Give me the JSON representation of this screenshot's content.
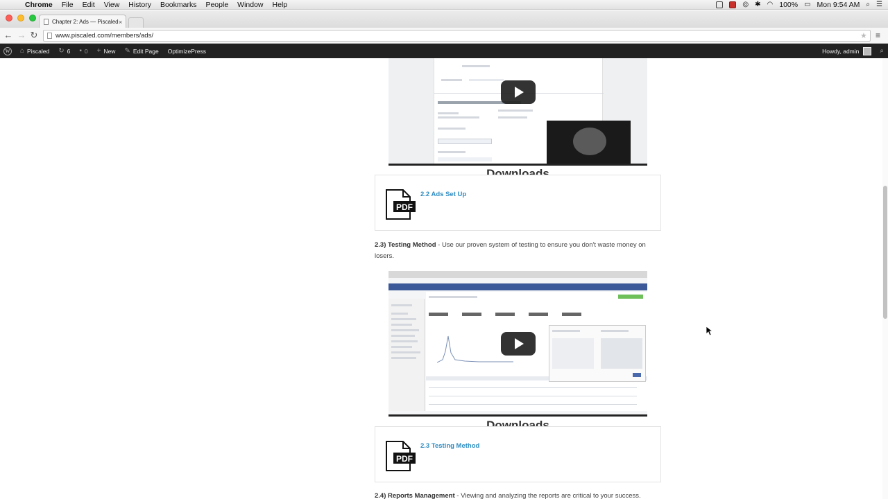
{
  "mac_menubar": {
    "items": [
      "Chrome",
      "File",
      "Edit",
      "View",
      "History",
      "Bookmarks",
      "People",
      "Window",
      "Help"
    ],
    "battery": "100%",
    "clock": "Mon 9:54 AM"
  },
  "browser": {
    "tab_title": "Chapter 2: Ads — Piscaled",
    "tab_close": "×",
    "url": "www.piscaled.com/members/ads/"
  },
  "wp_admin_bar": {
    "site_name": "Piscaled",
    "updates_count": "6",
    "comments_count": "0",
    "new_label": "New",
    "edit_page_label": "Edit Page",
    "optimizepress_label": "OptimizePress",
    "howdy": "Howdy, admin"
  },
  "sections": [
    {
      "downloads_heading": "Downloads",
      "download_link": "2.2 Ads Set Up",
      "pdf_label": "PDF"
    },
    {
      "title": "2.3) Testing Method",
      "description": " - Use our proven system of testing to ensure you don't waste money on losers.",
      "downloads_heading": "Downloads",
      "download_link": "2.3 Testing Method",
      "pdf_label": "PDF"
    },
    {
      "title": "2.4) Reports Management",
      "description": " - Viewing and analyzing the reports are critical to your success."
    }
  ],
  "icons": {
    "apple": "apple-icon",
    "play": "play-icon",
    "pdf": "pdf-file-icon"
  },
  "colors": {
    "link": "#2e8cc1",
    "wp_bar": "#222222",
    "facebook": "#3b5998"
  }
}
